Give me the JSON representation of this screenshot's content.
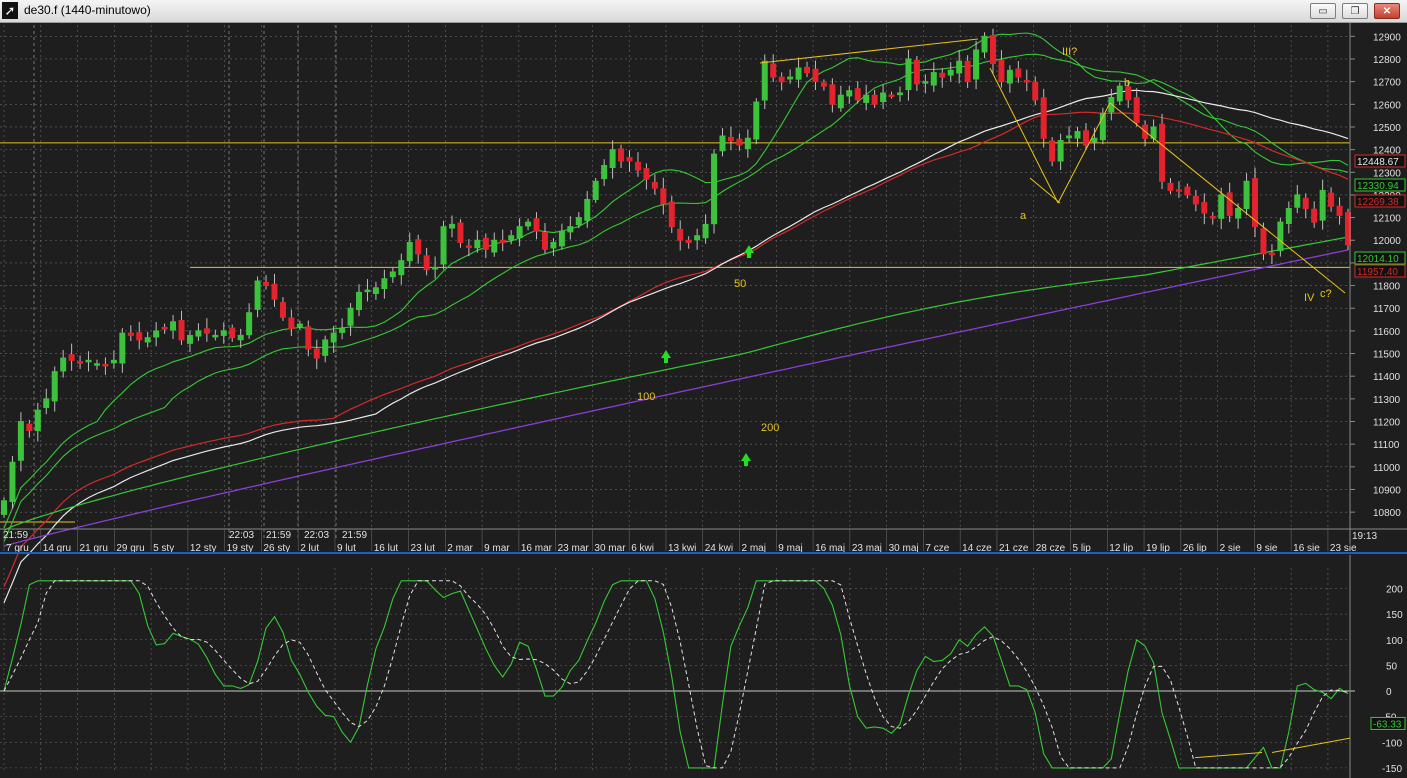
{
  "window": {
    "title": "de30.f (1440-minutowo)",
    "icon": "app-cursor-icon",
    "min_glyph": "▭",
    "max_glyph": "❐",
    "close_glyph": "✕"
  },
  "colors": {
    "background": "#1e1e1e",
    "grid": "#6a6a6a",
    "up_candle": "#3cc23c",
    "down_candle": "#e3232d",
    "ma_red": "#d42a2a",
    "ma_white": "#e8e8e8",
    "ma_green": "#36c836",
    "ma_purple": "#8c3ed8",
    "annotation": "#e6c31d",
    "divider": "#1a5fbf"
  },
  "chart_data": [
    {
      "type": "candlestick",
      "symbol": "de30.f",
      "ylim": [
        10730,
        12950
      ],
      "yticks": [
        10800,
        10900,
        11000,
        11100,
        11200,
        11300,
        11400,
        11500,
        11600,
        11700,
        11800,
        11900,
        12000,
        12100,
        12200,
        12300,
        12400,
        12500,
        12600,
        12700,
        12800,
        12900
      ],
      "xticks": [
        "7 gru",
        "14 gru",
        "21 gru",
        "29 gru",
        "5 sty",
        "12 sty",
        "19 sty",
        "26 sty",
        "2 lut",
        "9 lut",
        "16 lut",
        "23 lut",
        "2 mar",
        "9 mar",
        "16 mar",
        "23 mar",
        "30 mar",
        "6 kwi",
        "13 kwi",
        "24 kwi",
        "2 maj",
        "9 maj",
        "16 maj",
        "23 maj",
        "30 maj",
        "7 cze",
        "14 cze",
        "21 cze",
        "28 cze",
        "5 lip",
        "12 lip",
        "19 lip",
        "26 lip",
        "2 sie",
        "9 sie",
        "16 sie",
        "23 sie"
      ],
      "time_markers": [
        "21:59",
        "22:03",
        "21:59",
        "22:03",
        "21:59"
      ],
      "last_time": "19:13",
      "closes": [
        10850,
        11020,
        11200,
        11160,
        11250,
        11300,
        11420,
        11480,
        11470,
        11460,
        11470,
        11455,
        11450,
        11470,
        11590,
        11580,
        11560,
        11570,
        11600,
        11610,
        11640,
        11560,
        11580,
        11600,
        11590,
        11580,
        11600,
        11570,
        11580,
        11680,
        11820,
        11800,
        11740,
        11660,
        11610,
        11630,
        11520,
        11480,
        11560,
        11590,
        11610,
        11700,
        11770,
        11780,
        11790,
        11830,
        11860,
        11910,
        11990,
        11940,
        11870,
        11880,
        12060,
        12070,
        11990,
        11970,
        12000,
        11960,
        12000,
        11990,
        12020,
        12060,
        12080,
        12040,
        11960,
        11990,
        12040,
        12060,
        12100,
        12180,
        12260,
        12330,
        12400,
        12350,
        12350,
        12310,
        12270,
        12230,
        12160,
        12060,
        12000,
        11990,
        12020,
        12070,
        12380,
        12460,
        12440,
        12420,
        12450,
        12610,
        12790,
        12720,
        12700,
        12720,
        12760,
        12740,
        12700,
        12680,
        12600,
        12640,
        12660,
        12620,
        12640,
        12600,
        12650,
        12640,
        12650,
        12800,
        12690,
        12700,
        12740,
        12720,
        12750,
        12790,
        12700,
        12840,
        12900,
        12780,
        12700,
        12750,
        12720,
        12700,
        12620,
        12450,
        12350,
        12440,
        12460,
        12480,
        12420,
        12450,
        12560,
        12630,
        12680,
        12620,
        12520,
        12450,
        12500,
        12260,
        12220,
        12220,
        12200,
        12160,
        12120,
        12100,
        12200,
        12110,
        12140,
        12260,
        12060,
        11940,
        11940,
        12080,
        12140,
        12200,
        12140,
        12080,
        12220,
        12150,
        12110,
        11980
      ],
      "moving_averages": [
        {
          "color_key": "ma_green",
          "label": "",
          "last": 12330.94
        },
        {
          "color_key": "ma_white",
          "label": "",
          "last": 12448.67
        },
        {
          "color_key": "ma_red",
          "label": "",
          "last": 12269.38
        },
        {
          "color_key": "ma_green",
          "label": "50",
          "last": 12014.1
        },
        {
          "color_key": "ma_purple",
          "label": "200",
          "last": 11957.4
        }
      ],
      "price_labels": [
        {
          "text": "12448.67",
          "value": 12448.67,
          "color_key": "ma_white",
          "border": "#d42a2a"
        },
        {
          "text": "12330.94",
          "value": 12330.94,
          "color_key": "ma_green",
          "border": "#36c836"
        },
        {
          "text": "12269.38",
          "value": 12269.38,
          "color_key": "ma_red",
          "border": "#d42a2a"
        },
        {
          "text": "12014.10",
          "value": 12014.1,
          "color_key": "ma_green",
          "border": "#36c836"
        },
        {
          "text": "11957.40",
          "value": 11957.4,
          "color_key": "ma_red",
          "border": "#d42a2a"
        }
      ],
      "horizontal_lines": [
        12430,
        11880
      ],
      "annotations": [
        "III?",
        "b",
        "a",
        "IV",
        "c?",
        "50",
        "100",
        "200"
      ]
    },
    {
      "type": "line",
      "name": "oscillator",
      "ylim": [
        -160,
        240
      ],
      "yticks": [
        -150,
        -100,
        -50,
        0,
        50,
        100,
        150,
        200
      ],
      "last": -63.33,
      "last_label": "-63.33"
    }
  ]
}
